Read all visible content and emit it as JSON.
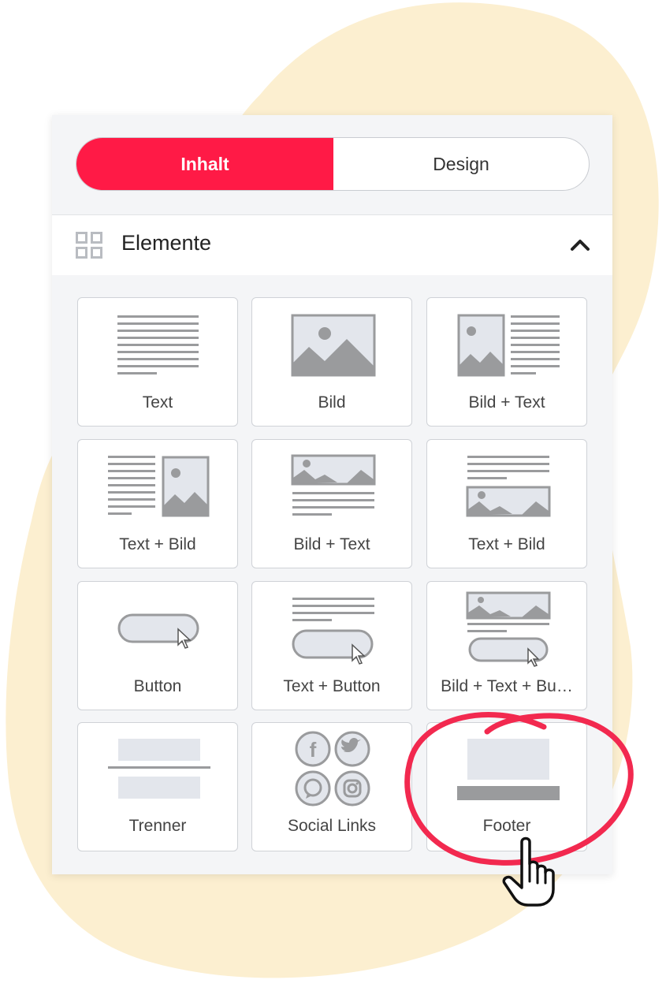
{
  "tabs": [
    {
      "label": "Inhalt",
      "active": true
    },
    {
      "label": "Design",
      "active": false
    }
  ],
  "section": {
    "title": "Elemente",
    "collapse_icon": "chevron-up-icon",
    "grid_icon": "grid-icon"
  },
  "tiles": [
    {
      "label": "Text",
      "icon": "text-block-icon"
    },
    {
      "label": "Bild",
      "icon": "image-icon"
    },
    {
      "label": "Bild + Text",
      "icon": "image-left-text-icon"
    },
    {
      "label": "Text + Bild",
      "icon": "text-image-right-icon"
    },
    {
      "label": "Bild + Text",
      "icon": "image-top-text-icon"
    },
    {
      "label": "Text + Bild",
      "icon": "text-top-image-icon"
    },
    {
      "label": "Button",
      "icon": "button-icon"
    },
    {
      "label": "Text + Button",
      "icon": "text-button-icon"
    },
    {
      "label": "Bild + Text + Bu…",
      "icon": "image-text-button-icon"
    },
    {
      "label": "Trenner",
      "icon": "divider-icon"
    },
    {
      "label": "Social Links",
      "icon": "social-links-icon"
    },
    {
      "label": "Footer",
      "icon": "footer-icon"
    }
  ],
  "colors": {
    "accent": "#ff1a46",
    "background_blob": "#fcefd0",
    "icon_gray": "#9a9b9d",
    "icon_light": "#e3e6ec"
  }
}
